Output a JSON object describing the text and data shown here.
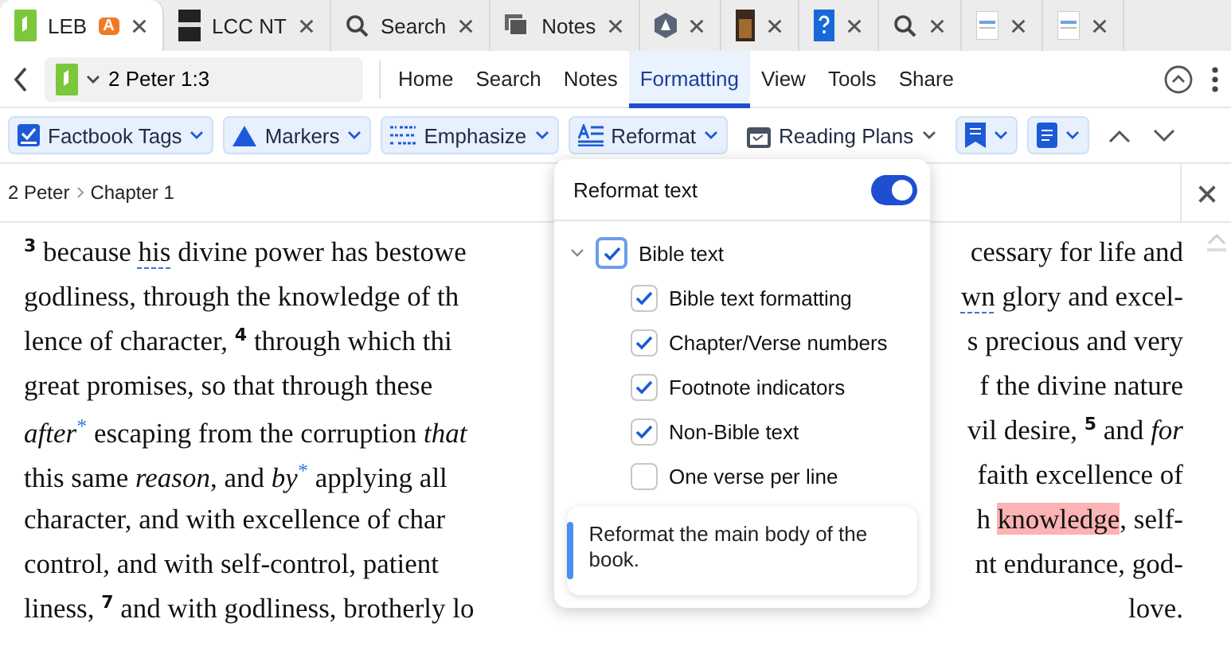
{
  "tabs": [
    {
      "label": "LEB",
      "badge": "A",
      "selected": true
    },
    {
      "label": "LCC NT",
      "selected": false
    },
    {
      "label": "Search",
      "selected": false
    },
    {
      "label": "Notes",
      "selected": false
    },
    {
      "selected": false
    },
    {
      "selected": false
    },
    {
      "selected": false
    },
    {
      "selected": false
    },
    {
      "selected": false
    },
    {
      "selected": false
    }
  ],
  "nav": {
    "reference": "2 Peter 1:3",
    "menu": [
      {
        "label": "Home",
        "selected": false
      },
      {
        "label": "Search",
        "selected": false
      },
      {
        "label": "Notes",
        "selected": false
      },
      {
        "label": "Formatting",
        "selected": true
      },
      {
        "label": "View",
        "selected": false
      },
      {
        "label": "Tools",
        "selected": false
      },
      {
        "label": "Share",
        "selected": false
      }
    ]
  },
  "toolbar": [
    {
      "label": "Factbook Tags",
      "kind": "filled"
    },
    {
      "label": "Markers",
      "kind": "filled"
    },
    {
      "label": "Emphasize",
      "kind": "filled"
    },
    {
      "label": "Reformat",
      "kind": "filled"
    },
    {
      "label": "Reading Plans",
      "kind": "plain"
    },
    {
      "kind": "filled"
    },
    {
      "kind": "filled"
    }
  ],
  "breadcrumb": [
    "2 Peter",
    "Chapter 1"
  ],
  "lines": [
    {
      "left": [
        {
          "kind": "verse",
          "text": "3"
        },
        {
          "kind": "plain",
          "text": " because "
        },
        {
          "kind": "underline",
          "text": "his"
        },
        {
          "kind": "plain",
          "text": " divine power has bestowe"
        }
      ],
      "right": [
        {
          "kind": "plain",
          "text": "cessary for life and"
        }
      ]
    },
    {
      "left": [
        {
          "kind": "plain",
          "text": "godliness, through the knowledge of th"
        }
      ],
      "right": [
        {
          "kind": "underline",
          "text": "wn"
        },
        {
          "kind": "plain",
          "text": " glory and excel-"
        }
      ]
    },
    {
      "left": [
        {
          "kind": "plain",
          "text": "lence of character, "
        },
        {
          "kind": "verse",
          "text": "4"
        },
        {
          "kind": "plain",
          "text": " through which thi"
        }
      ],
      "right": [
        {
          "kind": "plain",
          "text": "s precious and very"
        }
      ]
    },
    {
      "left": [
        {
          "kind": "plain",
          "text": "great promises, so that through these"
        }
      ],
      "right": [
        {
          "kind": "plain",
          "text": "f the divine nature"
        }
      ]
    },
    {
      "left": [
        {
          "kind": "italic",
          "text": "after"
        },
        {
          "kind": "footnote",
          "text": "*"
        },
        {
          "kind": "plain",
          "text": " escaping from the corruption "
        },
        {
          "kind": "italic",
          "text": "that"
        }
      ],
      "right": [
        {
          "kind": "plain",
          "text": "vil desire, "
        },
        {
          "kind": "verse",
          "text": "5"
        },
        {
          "kind": "plain",
          "text": " and "
        },
        {
          "kind": "italic",
          "text": "for"
        }
      ]
    },
    {
      "left": [
        {
          "kind": "plain",
          "text": "this same "
        },
        {
          "kind": "italic",
          "text": "reason"
        },
        {
          "kind": "plain",
          "text": ", and "
        },
        {
          "kind": "italic",
          "text": "by"
        },
        {
          "kind": "footnote",
          "text": "*"
        },
        {
          "kind": "plain",
          "text": " applying all"
        }
      ],
      "right": [
        {
          "kind": "plain",
          "text": "faith excellence of"
        }
      ]
    },
    {
      "left": [
        {
          "kind": "plain",
          "text": "character, and with excellence of char"
        }
      ],
      "right": [
        {
          "kind": "plain",
          "text": "h "
        },
        {
          "kind": "highlight",
          "text": "knowledge"
        },
        {
          "kind": "plain",
          "text": ", self-"
        }
      ]
    },
    {
      "left": [
        {
          "kind": "plain",
          "text": "control, and with self-control, patient"
        }
      ],
      "right": [
        {
          "kind": "plain",
          "text": "nt endurance, god-"
        }
      ]
    },
    {
      "left": [
        {
          "kind": "plain",
          "text": "liness, "
        },
        {
          "kind": "verse",
          "text": "7"
        },
        {
          "kind": "plain",
          "text": " and with godliness, brotherly lo"
        }
      ],
      "right": [
        {
          "kind": "plain",
          "text": "love."
        }
      ]
    }
  ],
  "popup": {
    "title": "Reformat text",
    "on": true,
    "tree": [
      {
        "label": "Bible text",
        "checked": true,
        "expanded": true,
        "children": [
          {
            "label": "Bible text formatting",
            "checked": true
          },
          {
            "label": "Chapter/Verse numbers",
            "checked": true
          },
          {
            "label": "Footnote indicators",
            "checked": true
          },
          {
            "label": "Non-Bible text",
            "checked": true
          },
          {
            "label": "One verse per line",
            "checked": false
          }
        ]
      }
    ],
    "info": "Reformat the main body of the book."
  }
}
